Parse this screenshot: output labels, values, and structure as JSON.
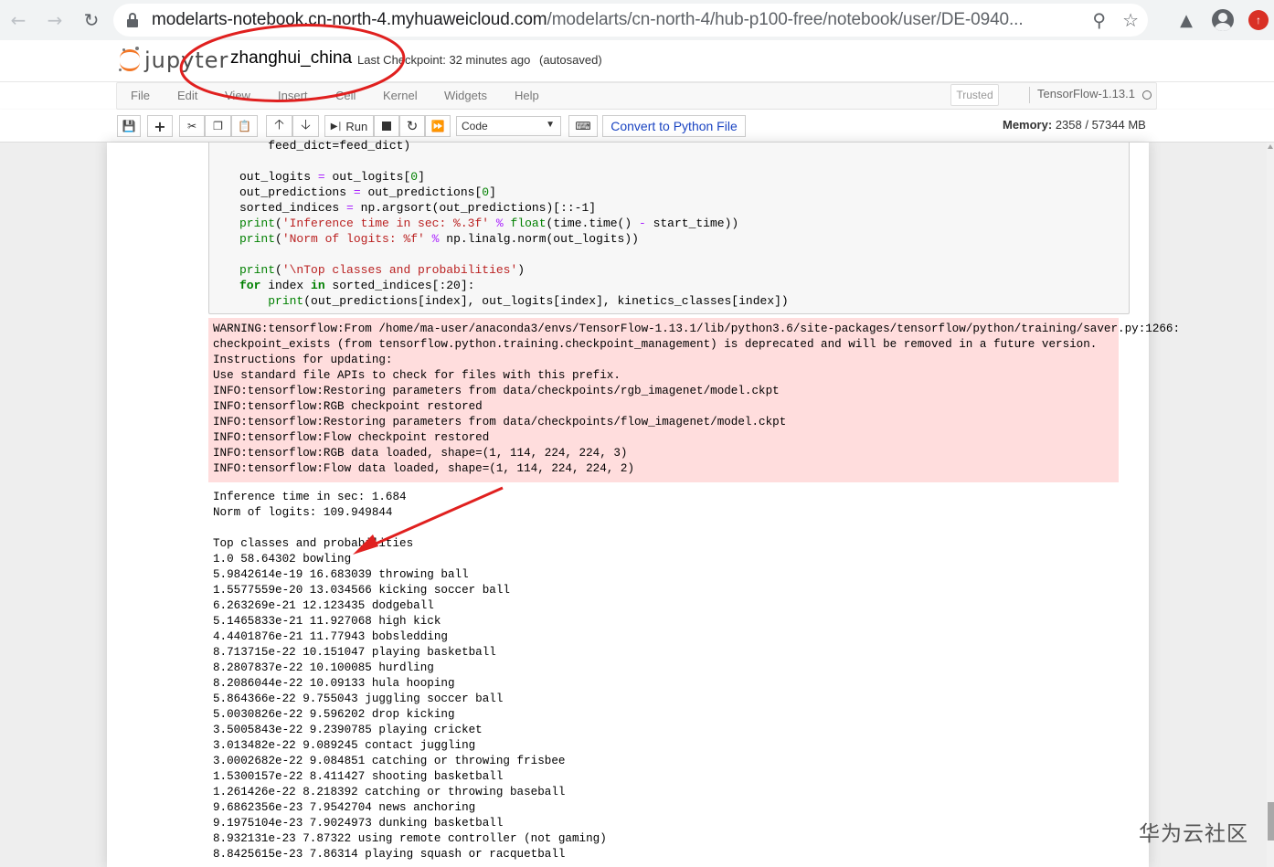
{
  "browser": {
    "url_host": "modelarts-notebook.cn-north-4.myhuaweicloud.com",
    "url_path": "/modelarts/cn-north-4/hub-p100-free/notebook/user/DE-0940..."
  },
  "jupyter": {
    "logo_text": "jupyter",
    "notebook_name": "zhanghui_china",
    "checkpoint": "Last Checkpoint: 32 minutes ago",
    "autosaved": "(autosaved)",
    "menu": [
      "File",
      "Edit",
      "View",
      "Insert",
      "Cell",
      "Kernel",
      "Widgets",
      "Help"
    ],
    "trusted": "Trusted",
    "kernel": "TensorFlow-1.13.1",
    "toolbar": {
      "run": "Run",
      "cell_type": "Code",
      "convert": "Convert to Python File"
    },
    "memory_label": "Memory:",
    "memory_value": "2358 / 57344 MB"
  },
  "code_lines": [
    "    feed_dict=feed_dict)",
    "",
    "out_logits = out_logits[0]",
    "out_predictions = out_predictions[0]",
    "sorted_indices = np.argsort(out_predictions)[::-1]",
    "print('Inference time in sec: %.3f' % float(time.time() - start_time))",
    "print('Norm of logits: %f' % np.linalg.norm(out_logits))",
    "",
    "print('\\nTop classes and probabilities')",
    "for index in sorted_indices[:20]:",
    "    print(out_predictions[index], out_logits[index], kinetics_classes[index])"
  ],
  "stderr_lines": [
    "WARNING:tensorflow:From /home/ma-user/anaconda3/envs/TensorFlow-1.13.1/lib/python3.6/site-packages/tensorflow/python/training/saver.py:1266:",
    "checkpoint_exists (from tensorflow.python.training.checkpoint_management) is deprecated and will be removed in a future version.",
    "Instructions for updating:",
    "Use standard file APIs to check for files with this prefix.",
    "INFO:tensorflow:Restoring parameters from data/checkpoints/rgb_imagenet/model.ckpt",
    "INFO:tensorflow:RGB checkpoint restored",
    "INFO:tensorflow:Restoring parameters from data/checkpoints/flow_imagenet/model.ckpt",
    "INFO:tensorflow:Flow checkpoint restored",
    "INFO:tensorflow:RGB data loaded, shape=(1, 114, 224, 224, 3)",
    "INFO:tensorflow:Flow data loaded, shape=(1, 114, 224, 224, 2)"
  ],
  "stdout_lines": [
    "Inference time in sec: 1.684",
    "Norm of logits: 109.949844",
    "",
    "Top classes and probabilities",
    "1.0 58.64302 bowling",
    "5.9842614e-19 16.683039 throwing ball",
    "1.5577559e-20 13.034566 kicking soccer ball",
    "6.263269e-21 12.123435 dodgeball",
    "5.1465833e-21 11.927068 high kick",
    "4.4401876e-21 11.77943 bobsledding",
    "8.713715e-22 10.151047 playing basketball",
    "8.2807837e-22 10.100085 hurdling",
    "8.2086044e-22 10.09133 hula hooping",
    "5.864366e-22 9.755043 juggling soccer ball",
    "5.0030826e-22 9.596202 drop kicking",
    "3.5005843e-22 9.2390785 playing cricket",
    "3.013482e-22 9.089245 contact juggling",
    "3.0002682e-22 9.084851 catching or throwing frisbee",
    "1.5300157e-22 8.411427 shooting basketball",
    "1.261426e-22 8.218392 catching or throwing baseball",
    "9.6862356e-23 7.9542704 news anchoring",
    "9.1975104e-23 7.9024973 dunking basketball",
    "8.932131e-23 7.87322 using remote controller (not gaming)",
    "8.8425615e-23 7.86314 playing squash or racquetball"
  ],
  "watermark": "华为云社区",
  "colors": {
    "annotation_red": "#e0201f",
    "stderr_bg": "#ffdddd",
    "jupyter_orange": "#f37726",
    "convert_blue": "#1a44c2"
  }
}
